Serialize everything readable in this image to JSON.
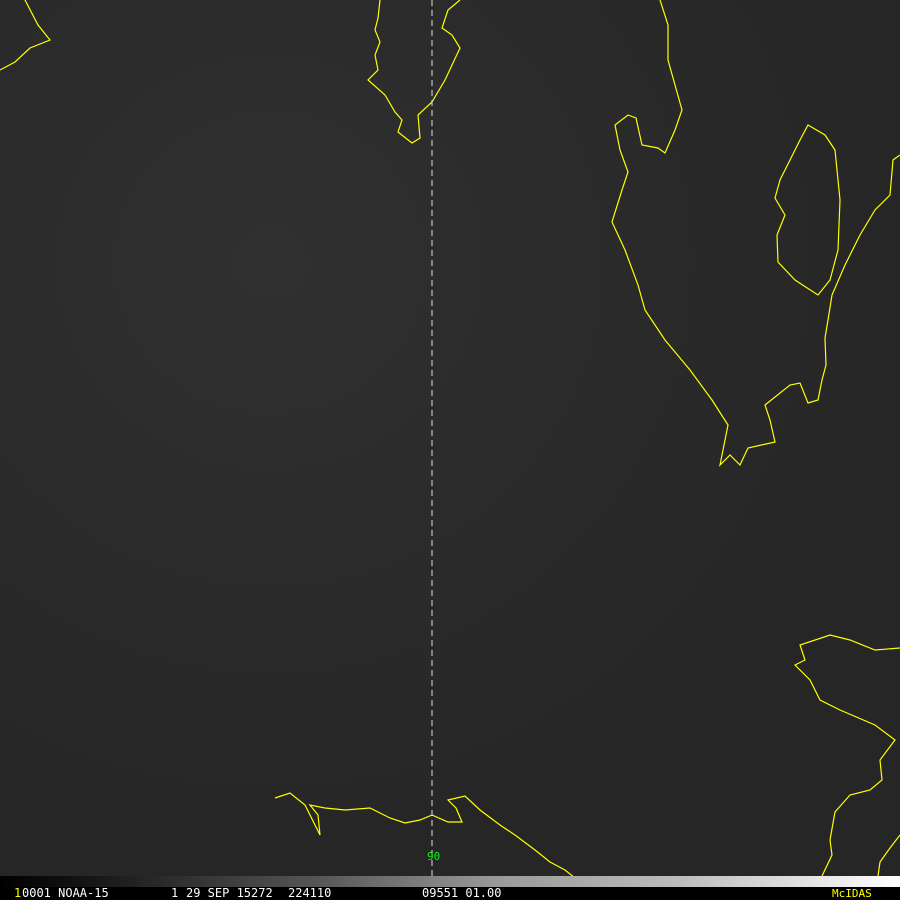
{
  "frame_number": "1",
  "header": {
    "image_id": "0001 NOAA-15",
    "band": "1",
    "date": "29 SEP 15272",
    "time": "224110",
    "center": "09551 01.00",
    "brand": "McIDAS"
  },
  "meridian_label": "90",
  "colors": {
    "coastline": "#ffff00",
    "text": "#ffffff",
    "brand": "#ffff00",
    "label": "#00ff00"
  }
}
